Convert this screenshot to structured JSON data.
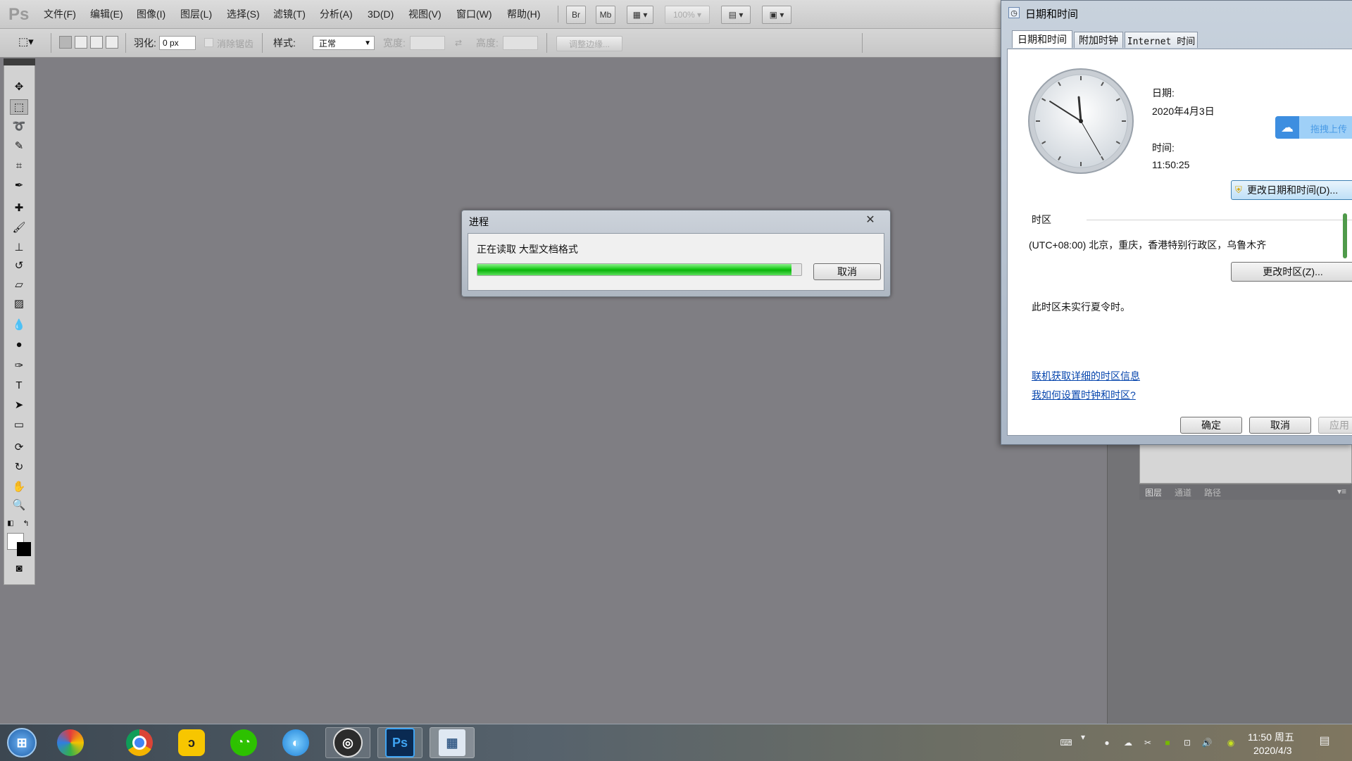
{
  "photoshop": {
    "logo": "Ps",
    "menus": [
      "文件(F)",
      "编辑(E)",
      "图像(I)",
      "图层(L)",
      "选择(S)",
      "滤镜(T)",
      "分析(A)",
      "3D(D)",
      "视图(V)",
      "窗口(W)",
      "帮助(H)"
    ],
    "menu_buttons": [
      "Br",
      "Mb"
    ],
    "zoom": "100%",
    "options": {
      "feather_label": "羽化:",
      "feather_value": "0 px",
      "antialias_label": "消除锯齿",
      "style_label": "样式:",
      "style_value": "正常",
      "width_label": "宽度:",
      "height_label": "高度:",
      "refine_edge": "调整边缘..."
    },
    "panel_tabs": [
      "图层",
      "通道",
      "路径"
    ]
  },
  "progress_dialog": {
    "title": "进程",
    "message": "正在读取 大型文档格式",
    "progress": 0.97,
    "cancel": "取消",
    "close_glyph": "✕"
  },
  "datetime_dialog": {
    "title": "日期和时间",
    "tabs": [
      "日期和时间",
      "附加时钟",
      "Internet 时间"
    ],
    "date_label": "日期:",
    "date_value": "2020年4月3日",
    "time_label": "时间:",
    "time_value": "11:50:25",
    "change_datetime": "更改日期和时间(D)...",
    "tz_label": "时区",
    "tz_value": "(UTC+08:00) 北京，重庆，香港特别行政区，乌鲁木齐",
    "change_tz": "更改时区(Z)...",
    "dst_note": "此时区未实行夏令时。",
    "link1": "联机获取详细的时区信息",
    "link2": "我如何设置时钟和时区?",
    "ok": "确定",
    "cancel": "取消",
    "apply": "应用",
    "upload_text": "拖拽上传"
  },
  "taskbar": {
    "ps_label": "Ps",
    "clock_time": "11:50 周五",
    "clock_date": "2020/4/3"
  },
  "colors": {
    "progress_green": "#16c916",
    "link_blue": "#0645ad"
  }
}
